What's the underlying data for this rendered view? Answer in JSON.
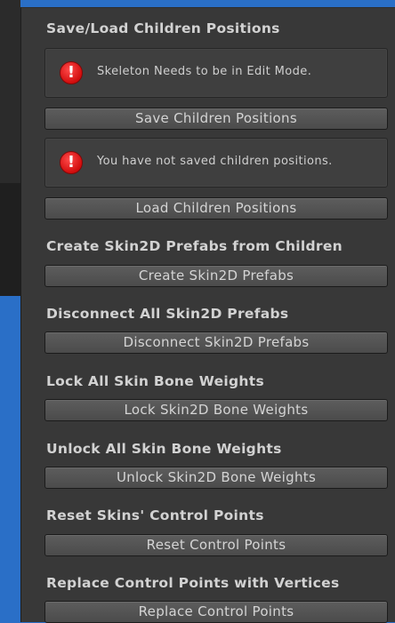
{
  "inspector": {
    "save_load": {
      "title": "Save/Load Children Positions",
      "error_edit_mode": "Skeleton Needs to be in Edit Mode.",
      "save_button": "Save Children Positions",
      "error_not_saved": "You have not saved children positions.",
      "load_button": "Load Children Positions"
    },
    "create_prefabs": {
      "title": "Create Skin2D Prefabs from Children",
      "button": "Create Skin2D Prefabs"
    },
    "disconnect_prefabs": {
      "title": "Disconnect All Skin2D Prefabs",
      "button": "Disconnect Skin2D Prefabs"
    },
    "lock_weights": {
      "title": "Lock All Skin Bone Weights",
      "button": "Lock Skin2D Bone Weights"
    },
    "unlock_weights": {
      "title": "Unlock All Skin Bone Weights",
      "button": "Unlock Skin2D Bone Weights"
    },
    "reset_control_points": {
      "title": "Reset Skins' Control Points",
      "button": "Reset Control Points"
    },
    "replace_control_points": {
      "title": "Replace Control Points with Vertices",
      "button": "Replace Control Points"
    }
  },
  "icons": {
    "error_glyph": "!",
    "error_icon_name": "error-icon"
  },
  "colors": {
    "panel_bg": "#383838",
    "button_bg": "#555555",
    "error_red": "#e01515",
    "desktop_blue": "#2a6fc7"
  }
}
